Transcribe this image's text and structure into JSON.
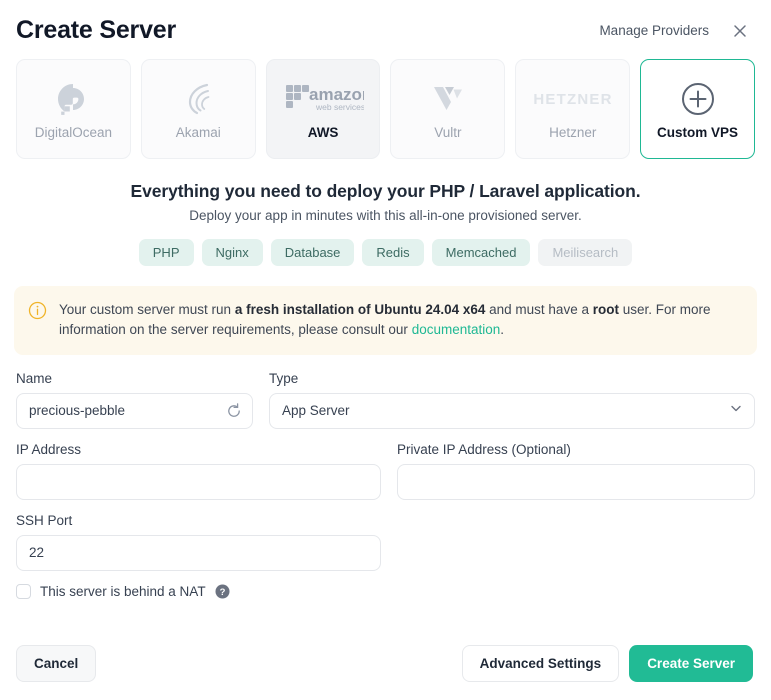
{
  "header": {
    "title": "Create Server",
    "manage_providers": "Manage Providers",
    "close_icon": "close-icon"
  },
  "providers": [
    {
      "name": "DigitalOcean",
      "logo": "digitalocean-logo",
      "state": "default"
    },
    {
      "name": "Akamai",
      "logo": "akamai-logo",
      "state": "default"
    },
    {
      "name": "AWS",
      "logo": "aws-logo",
      "logo_text": "amazon",
      "logo_subtext": "web services",
      "state": "hovered"
    },
    {
      "name": "Vultr",
      "logo": "vultr-logo",
      "state": "default"
    },
    {
      "name": "Hetzner",
      "logo": "hetzner-logo",
      "logo_text": "HETZNER",
      "state": "default"
    },
    {
      "name": "Custom VPS",
      "logo": "plus-circle-icon",
      "state": "selected"
    }
  ],
  "pitch": {
    "heading": "Everything you need to deploy your PHP / Laravel application.",
    "subheading": "Deploy your app in minutes with this all-in-one provisioned server.",
    "tags": [
      {
        "label": "PHP",
        "muted": false
      },
      {
        "label": "Nginx",
        "muted": false
      },
      {
        "label": "Database",
        "muted": false
      },
      {
        "label": "Redis",
        "muted": false
      },
      {
        "label": "Memcached",
        "muted": false
      },
      {
        "label": "Meilisearch",
        "muted": true
      }
    ]
  },
  "alert": {
    "icon": "info-circle-icon",
    "text_part1": "Your custom server must run ",
    "bold1": "a fresh installation of Ubuntu 24.04 x64",
    "text_part2": " and must have a ",
    "bold2": "root",
    "text_part3": " user. For more information on the server requirements, please consult our ",
    "link": "documentation",
    "text_part4": "."
  },
  "form": {
    "name": {
      "label": "Name",
      "value": "precious-pebble",
      "placeholder": "",
      "refresh_icon": "refresh-icon"
    },
    "type": {
      "label": "Type",
      "value": "App Server",
      "caret_icon": "chevron-down-icon"
    },
    "ip_address": {
      "label": "IP Address",
      "value": "",
      "placeholder": ""
    },
    "private_ip_address": {
      "label": "Private IP Address (Optional)",
      "value": "",
      "placeholder": ""
    },
    "ssh_port": {
      "label": "SSH Port",
      "value": "22",
      "placeholder": ""
    },
    "nat": {
      "label": "This server is behind a NAT",
      "checked": false,
      "help_icon": "question-circle-icon"
    }
  },
  "footer": {
    "cancel": "Cancel",
    "advanced_settings": "Advanced Settings",
    "create_server": "Create Server"
  },
  "colors": {
    "accent": "#21bb95",
    "alert_bg": "#fdf8ec",
    "alert_icon": "#f0b429",
    "tag_bg": "#e3f2ee",
    "tag_text": "#3d6b63"
  }
}
